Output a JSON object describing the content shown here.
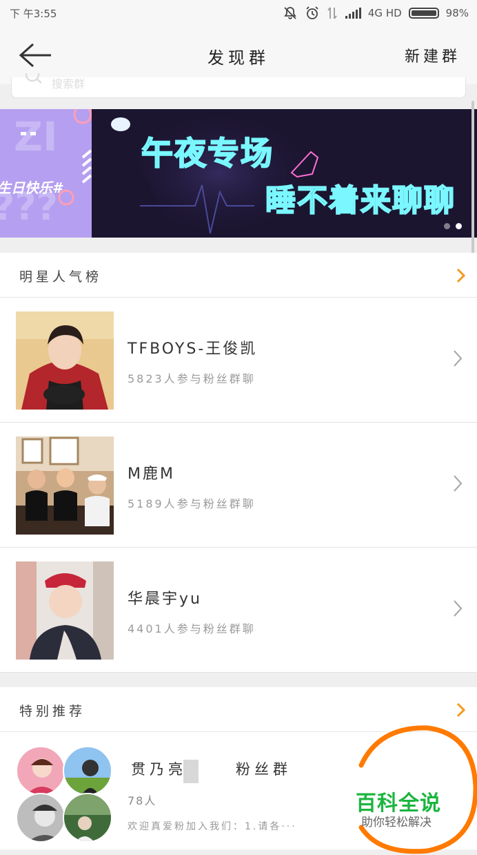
{
  "status_bar": {
    "time": "下 午3:55",
    "network": "4G HD",
    "battery": "98%"
  },
  "nav": {
    "title": "发现群",
    "action": "新建群",
    "back_icon": "back-arrow-icon"
  },
  "search": {
    "placeholder": "搜索群"
  },
  "banner": {
    "left_tag": "生日快乐#",
    "line1": "午夜专场",
    "line2": "睡不着来聊聊",
    "slide_count": 2,
    "active_slide": 2
  },
  "star_ranking": {
    "title": "明星人气榜",
    "items": [
      {
        "name": "TFBOYS-王俊凯",
        "participants": "5823人参与粉丝群聊"
      },
      {
        "name": "M鹿M",
        "participants": "5189人参与粉丝群聊"
      },
      {
        "name": "华晨宇yu",
        "participants": "4401人参与粉丝群聊"
      }
    ]
  },
  "special_recommend": {
    "title": "特别推荐",
    "item": {
      "name_part1": "贯乃亮",
      "name_part2": "粉丝群",
      "members": "78人",
      "description": "欢迎真爱粉加入我们：1.请各···"
    }
  },
  "watermark": {
    "title": "百科全说",
    "subtitle": "助你轻松解决"
  },
  "colors": {
    "accent": "#f39a1e",
    "watermark_green": "#1bb53f",
    "watermark_ring": "#ff7a00"
  }
}
